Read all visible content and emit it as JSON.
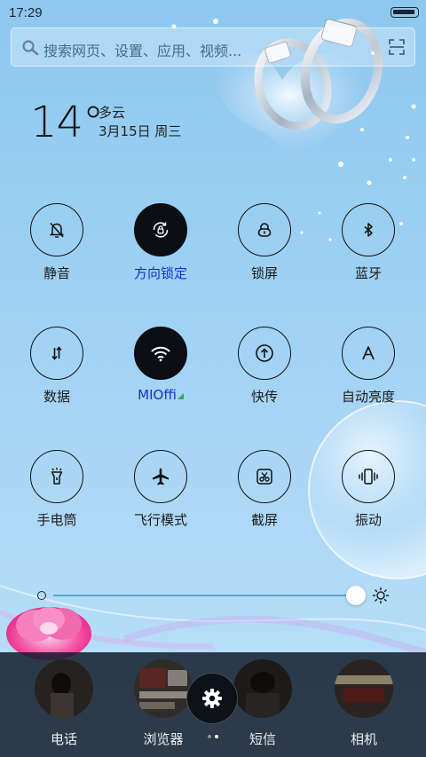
{
  "status_bar": {
    "time": "17:29"
  },
  "search": {
    "placeholder": "搜索网页、设置、应用、视频..."
  },
  "weather": {
    "temperature": "14°",
    "condition": "多云",
    "date": "3月15日 周三"
  },
  "toggles": [
    {
      "label": "静音",
      "icon": "bell-off-icon",
      "on": false
    },
    {
      "label": "方向锁定",
      "icon": "rotation-lock-icon",
      "on": true
    },
    {
      "label": "锁屏",
      "icon": "lock-icon",
      "on": false
    },
    {
      "label": "蓝牙",
      "icon": "bluetooth-icon",
      "on": false
    },
    {
      "label": "数据",
      "icon": "data-arrows-icon",
      "on": false
    },
    {
      "label": "MIOffi",
      "icon": "wifi-icon",
      "on": true
    },
    {
      "label": "快传",
      "icon": "transfer-icon",
      "on": false
    },
    {
      "label": "自动亮度",
      "icon": "auto-brightness-icon",
      "on": false
    },
    {
      "label": "手电筒",
      "icon": "flashlight-icon",
      "on": false
    },
    {
      "label": "飞行模式",
      "icon": "airplane-icon",
      "on": false
    },
    {
      "label": "截屏",
      "icon": "screenshot-icon",
      "on": false
    },
    {
      "label": "振动",
      "icon": "vibrate-icon",
      "on": false
    }
  ],
  "brightness": {
    "level": 0.96
  },
  "dock": {
    "apps": [
      {
        "label": "电话"
      },
      {
        "label": "浏览器"
      },
      {
        "label": "短信"
      },
      {
        "label": "相机"
      }
    ],
    "current_page": 2,
    "page_count": 2
  },
  "colors": {
    "active_label": "#1432c9",
    "toggle_on_bg": "#0b0e13",
    "slider_track": "#53a3dc"
  }
}
